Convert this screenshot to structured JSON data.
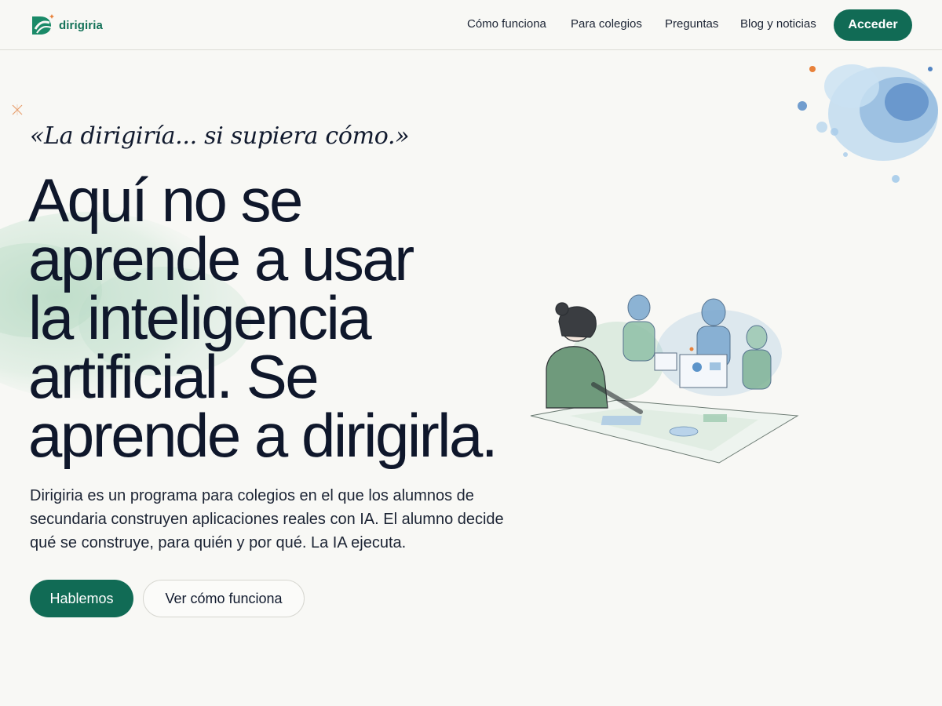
{
  "brand": {
    "name": "dirigiria",
    "accent": "#116b55",
    "logo_icon": "dirigiria-logo-icon"
  },
  "nav": {
    "items": [
      {
        "label": "Cómo funciona"
      },
      {
        "label": "Para colegios"
      },
      {
        "label": "Preguntas"
      },
      {
        "label": "Blog y noticias"
      }
    ],
    "cta": "Acceder"
  },
  "hero": {
    "quote": "«La dirigiría... si supiera cómo.»",
    "headline_lines": [
      "Aquí no se",
      "aprende a usar",
      "la inteligencia",
      "artificial. Se",
      "aprende a dirigirla."
    ],
    "description": "Dirigiria es un programa para colegios en el que los alumnos de secundaria construyen aplicaciones reales con IA. El alumno decide qué se construye, para quién y por qué. La IA ejecuta.",
    "primary_button": "Hablemos",
    "secondary_button": "Ver cómo funciona"
  },
  "colors": {
    "background": "#f8f8f5",
    "text": "#0f172b",
    "watercolor_green": "#8cc3a4",
    "watercolor_blue": "#5b93c9",
    "spark_orange": "#e8813a"
  }
}
